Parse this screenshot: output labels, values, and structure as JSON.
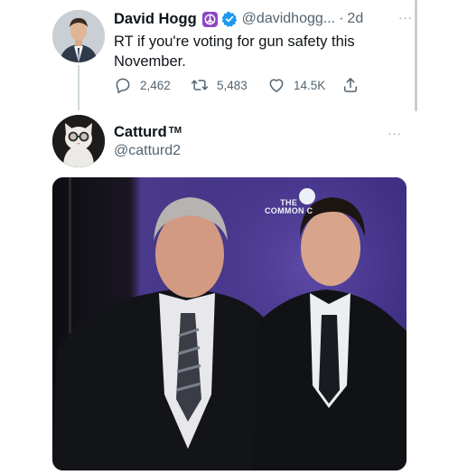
{
  "tweet_1": {
    "display_name": "David Hogg",
    "handle": "@davidhogg...",
    "separator": "·",
    "time": "2d",
    "more": "···",
    "text": "RT if you're voting for gun safety this November.",
    "replies": "2,462",
    "retweets": "5,483",
    "likes": "14.5K",
    "icons": [
      "peace-emoji-icon",
      "verified-badge-icon",
      "reply-icon",
      "retweet-icon",
      "like-icon",
      "share-icon",
      "more-icon"
    ]
  },
  "tweet_2": {
    "display_name": "Catturd",
    "tm": "TM",
    "handle": "@catturd2",
    "more": "···",
    "media_sign": {
      "line1": "THE",
      "line2": "COMMON C"
    }
  },
  "colors": {
    "text": "#0f1419",
    "secondary": "#536471",
    "verified": "#1d9bf0",
    "peace_emoji_bg": "#8a48c2",
    "backdrop_purple": "#3a2a78"
  }
}
